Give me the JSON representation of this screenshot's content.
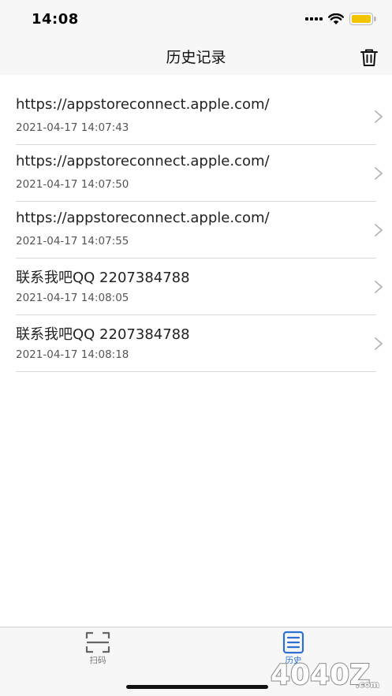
{
  "status_bar": {
    "time": "14:08"
  },
  "nav": {
    "title": "历史记录",
    "trash_icon": "trash-icon"
  },
  "history": [
    {
      "title": "https://appstoreconnect.apple.com/",
      "time": "2021-04-17 14:07:43"
    },
    {
      "title": "https://appstoreconnect.apple.com/",
      "time": "2021-04-17 14:07:50"
    },
    {
      "title": "https://appstoreconnect.apple.com/",
      "time": "2021-04-17 14:07:55"
    },
    {
      "title": "联系我吧QQ 2207384788",
      "time": "2021-04-17 14:08:05"
    },
    {
      "title": "联系我吧QQ 2207384788",
      "time": "2021-04-17 14:08:18"
    }
  ],
  "tabs": [
    {
      "label": "扫码",
      "icon": "scan-icon",
      "active": false
    },
    {
      "label": "历史",
      "icon": "document-icon",
      "active": true
    }
  ],
  "watermark": {
    "text": "4040Z.com"
  },
  "colors": {
    "accent": "#2f6fd0",
    "battery": "#f5c400",
    "bar_background": "#f7f7f7"
  }
}
